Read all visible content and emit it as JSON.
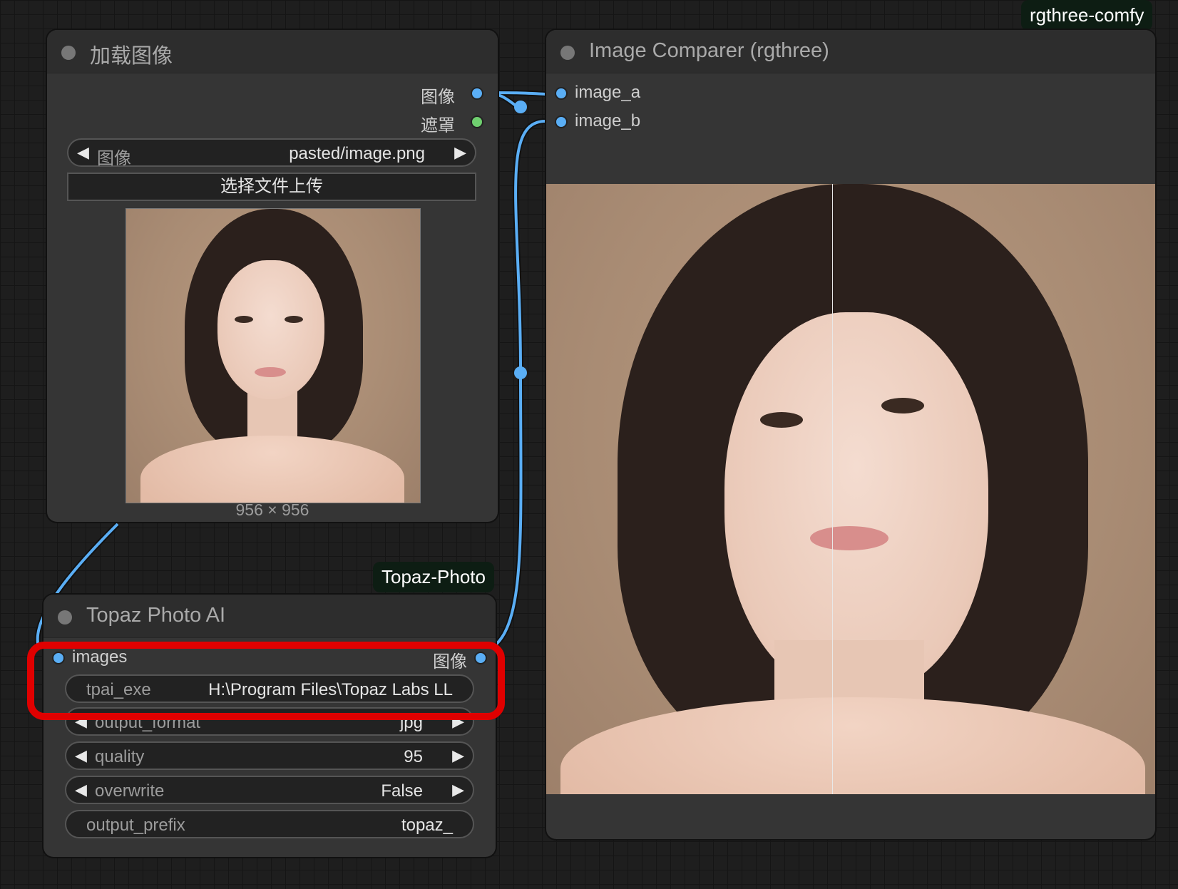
{
  "tags": {
    "rgthree": "rgthree-comfy",
    "topaz": "Topaz-Photo"
  },
  "load_image_node": {
    "title": "加载图像",
    "outputs": [
      "图像",
      "遮罩"
    ],
    "image_widget": {
      "label": "图像",
      "value": "pasted/image.png"
    },
    "upload_button": "选择文件上传",
    "preview_caption": "956 × 956"
  },
  "comparer_node": {
    "title": "Image Comparer (rgthree)",
    "inputs": [
      "image_a",
      "image_b"
    ]
  },
  "topaz_node": {
    "title": "Topaz Photo AI",
    "input": "images",
    "output": "图像",
    "widgets": [
      {
        "label": "tpai_exe",
        "value": "H:\\Program Files\\Topaz Labs LL"
      },
      {
        "label": "output_format",
        "value": "jpg"
      },
      {
        "label": "quality",
        "value": "95"
      },
      {
        "label": "overwrite",
        "value": "False"
      },
      {
        "label": "output_prefix",
        "value": "topaz_"
      }
    ]
  },
  "colors": {
    "image_slot": "#5aaef5",
    "mask_slot": "#6fcf6f",
    "link": "#5aaef5",
    "highlight": "#e00000"
  },
  "icons": {
    "arrow_left": "◀",
    "arrow_right": "▶"
  }
}
